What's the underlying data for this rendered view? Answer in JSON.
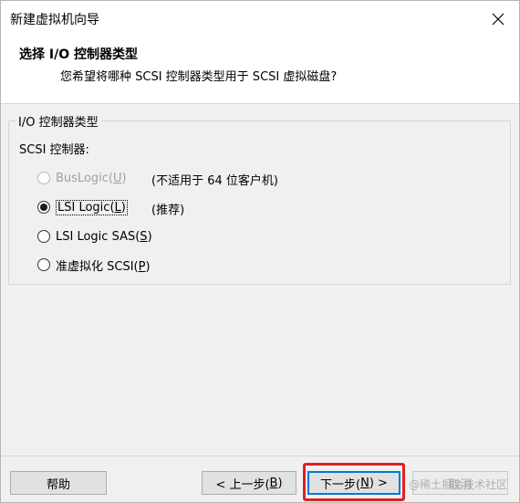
{
  "window": {
    "title": "新建虚拟机向导",
    "close_icon": "close-icon"
  },
  "header": {
    "title": "选择 I/O 控制器类型",
    "subtitle": "您希望将哪种 SCSI 控制器类型用于 SCSI 虚拟磁盘?"
  },
  "group": {
    "label": "I/O 控制器类型",
    "controller_label": "SCSI 控制器:",
    "options": [
      {
        "label_pre": "BusLogic(",
        "accel": "U",
        "label_post": ")",
        "note": "(不适用于 64 位客户机)",
        "checked": false,
        "disabled": true
      },
      {
        "label_pre": "LSI Logic(",
        "accel": "L",
        "label_post": ")",
        "note": "(推荐)",
        "checked": true,
        "disabled": false
      },
      {
        "label_pre": "LSI Logic SAS(",
        "accel": "S",
        "label_post": ")",
        "note": "",
        "checked": false,
        "disabled": false
      },
      {
        "label_pre": "准虚拟化 SCSI(",
        "accel": "P",
        "label_post": ")",
        "note": "",
        "checked": false,
        "disabled": false
      }
    ]
  },
  "footer": {
    "help": "帮助",
    "back_pre": "< 上一步(",
    "back_accel": "B",
    "back_post": ")",
    "next_pre": "下一步(",
    "next_accel": "N",
    "next_post": ") >",
    "cancel": "取消",
    "watermark": "@稀土掘金技术社区"
  },
  "colors": {
    "highlight": "#e02020",
    "focus_border": "#0078d7",
    "dialog_bg": "#f0f0f0"
  }
}
